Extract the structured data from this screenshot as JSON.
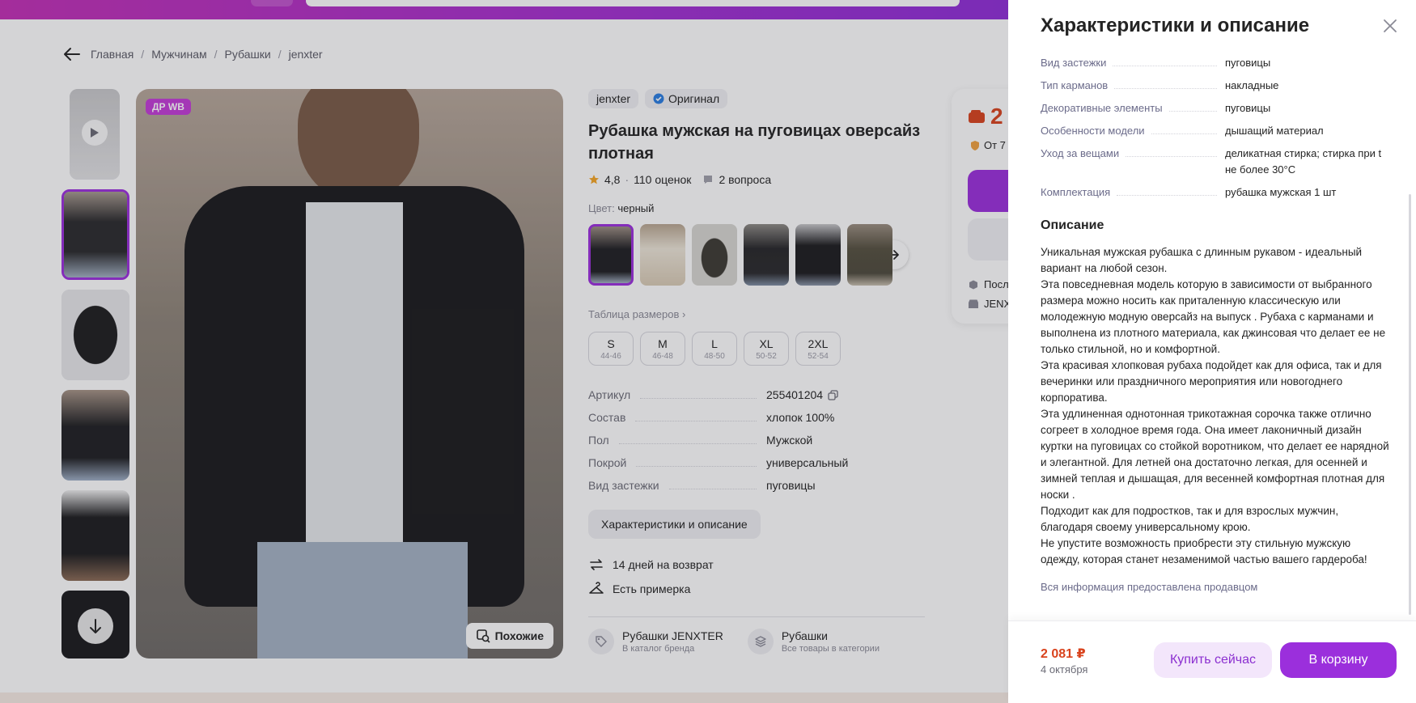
{
  "breadcrumb": [
    "Главная",
    "Мужчинам",
    "Рубашки",
    "jenxter"
  ],
  "product": {
    "badge": "ДР WB",
    "similar_label": "Похожие",
    "brand": "jenxter",
    "original_label": "Оригинал",
    "title": "Рубашка мужская на пуговицах оверсайз плотная",
    "rating": "4,8",
    "reviews": "110 оценок",
    "questions": "2 вопроса",
    "color_label": "Цвет:",
    "color_value": "черный",
    "size_table_label": "Таблица размеров",
    "sizes": [
      {
        "name": "S",
        "range": "44-46"
      },
      {
        "name": "M",
        "range": "46-48"
      },
      {
        "name": "L",
        "range": "48-50"
      },
      {
        "name": "XL",
        "range": "50-52"
      },
      {
        "name": "2XL",
        "range": "52-54"
      }
    ],
    "params": [
      {
        "k": "Артикул",
        "v": "255401204"
      },
      {
        "k": "Состав",
        "v": "хлопок 100%"
      },
      {
        "k": "Пол",
        "v": "Мужской"
      },
      {
        "k": "Покрой",
        "v": "универсальный"
      },
      {
        "k": "Вид застежки",
        "v": "пуговицы"
      }
    ],
    "characteristics_button": "Характеристики и описание",
    "return_label": "14 дней на возврат",
    "fitting_label": "Есть примерка",
    "brand_link": {
      "title": "Рубашки JENXTER",
      "subtitle": "В каталог бренда"
    },
    "category_link": {
      "title": "Рубашки",
      "subtitle": "Все товары в категории"
    }
  },
  "price_card": {
    "price_partial": "2",
    "from_partial": "От 7",
    "row1": "Посл",
    "row2": "JENX"
  },
  "panel": {
    "title": "Характеристики и описание",
    "props": [
      {
        "k": "Вид застежки",
        "v": "пуговицы"
      },
      {
        "k": "Тип карманов",
        "v": "накладные"
      },
      {
        "k": "Декоративные элементы",
        "v": "пуговицы"
      },
      {
        "k": "Особенности модели",
        "v": "дышащий материал"
      },
      {
        "k": "Уход за вещами",
        "v": "деликатная стирка; стирка при t не более 30°C"
      },
      {
        "k": "Комплектация",
        "v": "рубашка мужская 1 шт"
      }
    ],
    "description_heading": "Описание",
    "description": "Уникальная мужская рубашка с длинным рукавом - идеальный вариант на любой сезон.\nЭта повседневная модель которую в зависимости от выбранного размера можно носить как приталенную классическую или молодежную модную оверсайз на выпуск . Рубаха с карманами и выполнена из плотного материала, как джинсовая что делает ее не только стильной, но и комфортной.\nЭта красивая хлопковая рубаха подойдет как для офиса, так и для вечеринки или праздничного мероприятия или новогоднего корпоратива.\nЭта удлиненная однотонная трикотажная сорочка также отлично согреет в холодное время года. Она имеет лаконичный дизайн куртки на пуговицах со стойкой воротником, что делает ее нарядной и элегантной. Для летней она достаточно легкая, для осенней и зимней теплая и дышащая, для весенней комфортная плотная для носки .\nПодходит как для подростков, так и для взрослых мужчин, благодаря своему универсальному крою.\nНе упустите возможность приобрести эту стильную мужскую одежду, которая станет незаменимой частью вашего гардероба!",
    "seller_note": "Вся информация предоставлена продавцом",
    "footer": {
      "price": "2 081 ₽",
      "date": "4 октября",
      "buy_now": "Купить сейчас",
      "add_to_cart": "В корзину"
    }
  },
  "colors": {
    "accent": "#9b2fdc",
    "price": "#d9431d"
  }
}
